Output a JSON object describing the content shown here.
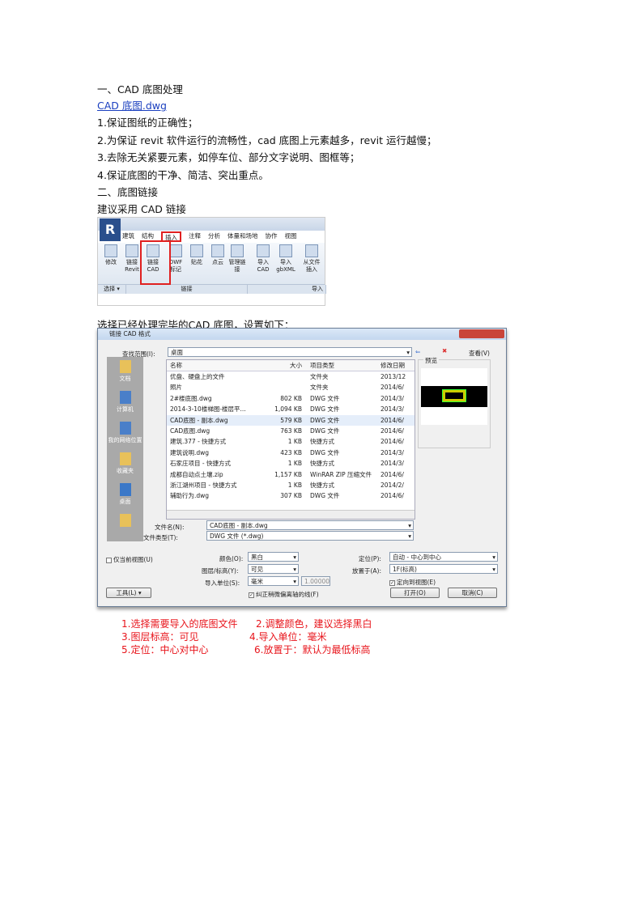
{
  "doc": {
    "lines": [
      "一、CAD 底图处理",
      "CAD 底图.dwg",
      "1.保证图纸的正确性；",
      "2.为保证 revit 软件运行的流畅性，cad 底图上元素越多，revit 运行越慢；",
      "3.去除无关紧要元素，如停车位、部分文字说明、图框等；",
      "4.保证底图的干净、简洁、突出重点。",
      "二、底图链接",
      "建议采用 CAD 链接"
    ],
    "after_ribbon": "选择已经处理完毕的CAD 底图，设置如下："
  },
  "ribbon": {
    "logo": "R",
    "tabs": [
      "建筑",
      "结构",
      "插入",
      "注释",
      "分析",
      "体量和场地",
      "协作",
      "视图"
    ],
    "active_tab": "插入",
    "buttons": [
      "修改",
      "链接 Revit",
      "链接 CAD",
      "DWF 标记",
      "贴花",
      "点云",
      "管理链接",
      "导入 CAD",
      "导入 gbXML",
      "从文件插入"
    ],
    "panels": [
      "选择 ▾",
      "链接",
      "导入"
    ],
    "highlight_color": "#e02020"
  },
  "dialog": {
    "title": "链接 CAD 格式",
    "look_in_label": "查找范围(I):",
    "look_in": "桌面",
    "views_label": "查看(V)",
    "preview_label": "预览",
    "places": [
      "文档",
      "计算机",
      "我的网络位置",
      "收藏夹",
      "桌面",
      ""
    ],
    "columns": [
      "名称",
      "大小",
      "项目类型",
      "修改日期"
    ],
    "files": [
      [
        "优盘、硬盘上的文件",
        "",
        "文件夹",
        "2013/12"
      ],
      [
        "照片",
        "",
        "文件夹",
        "2014/6/"
      ],
      [
        "2#楼底图.dwg",
        "802 KB",
        "DWG 文件",
        "2014/3/"
      ],
      [
        "2014-3-10楼梯图-楼层平...",
        "1,094 KB",
        "DWG 文件",
        "2014/3/"
      ],
      [
        "CAD底图 - 副本.dwg",
        "579 KB",
        "DWG 文件",
        "2014/6/"
      ],
      [
        "CAD底图.dwg",
        "763 KB",
        "DWG 文件",
        "2014/6/"
      ],
      [
        "建筑.377 - 快捷方式",
        "1 KB",
        "快捷方式",
        "2014/6/"
      ],
      [
        "建筑说明.dwg",
        "423 KB",
        "DWG 文件",
        "2014/3/"
      ],
      [
        "石家庄项目 - 快捷方式",
        "1 KB",
        "快捷方式",
        "2014/3/"
      ],
      [
        "成都自动点土壤.zip",
        "1,157 KB",
        "WinRAR ZIP 压缩文件",
        "2014/6/"
      ],
      [
        "浙江湖州项目 - 快捷方式",
        "1 KB",
        "快捷方式",
        "2014/2/"
      ],
      [
        "辅助行为.dwg",
        "307 KB",
        "DWG 文件",
        "2014/6/"
      ]
    ],
    "selected_index": 4,
    "filename_label": "文件名(N):",
    "filename": "CAD底图 - 副本.dwg",
    "filetype_label": "文件类型(T):",
    "filetype": "DWG 文件 (*.dwg)",
    "current_view_only": "仅当前视图(U)",
    "color_label": "颜色(O):",
    "color": "黑白",
    "layers_label": "图层/标高(Y):",
    "layers": "可见",
    "units_label": "导入单位(S):",
    "units": "毫米",
    "scale": "1.000000",
    "correct_lines": "纠正稍微偏离轴的线(F)",
    "position_label": "定位(P):",
    "position": "自动 - 中心到中心",
    "place_at_label": "放置于(A):",
    "place_at": "1F(标高)",
    "orient": "定向到视图(E)",
    "tools": "工具(L)",
    "open": "打开(O)",
    "cancel": "取消(C)"
  },
  "caption": [
    "1.选择需要导入的底图文件",
    "2.调整颜色，建议选择黑白",
    "3.图层标高：可见",
    "4.导入单位：毫米",
    "5.定位：中心对中心",
    "6.放置于：默认为最低标高"
  ],
  "colors": {
    "link": "#1a3fbf",
    "caption": "#e8141b"
  }
}
